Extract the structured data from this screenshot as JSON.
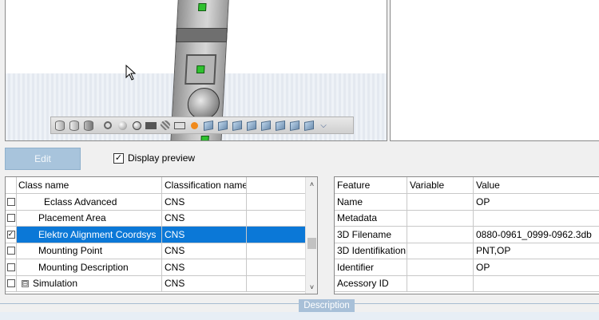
{
  "toolbar": {
    "edit_label": "Edit",
    "display_preview_label": "Display preview",
    "display_preview_checked": true
  },
  "class_table": {
    "headers": [
      "Class name",
      "Classification name"
    ],
    "rows": [
      {
        "name": "Eclass Advanced",
        "classification": "CNS",
        "checked": false,
        "selected": false,
        "indent": 2
      },
      {
        "name": "Placement Area",
        "classification": "CNS",
        "checked": false,
        "selected": false,
        "indent": 1
      },
      {
        "name": "Elektro Alignment Coordsys",
        "classification": "CNS",
        "checked": true,
        "selected": true,
        "indent": 1
      },
      {
        "name": "Mounting Point",
        "classification": "CNS",
        "checked": false,
        "selected": false,
        "indent": 1
      },
      {
        "name": "Mounting Description",
        "classification": "CNS",
        "checked": false,
        "selected": false,
        "indent": 1
      },
      {
        "name": "Simulation",
        "classification": "CNS",
        "checked": false,
        "selected": false,
        "indent": 0,
        "expander": "⊟"
      }
    ]
  },
  "feature_table": {
    "headers": [
      "Feature",
      "Variable",
      "Value"
    ],
    "rows": [
      {
        "feature": "Name",
        "variable": "",
        "value": "OP"
      },
      {
        "feature": "Metadata",
        "variable": "",
        "value": ""
      },
      {
        "feature": "3D Filename",
        "variable": "",
        "value": "0880-0961_0999-0962.3db"
      },
      {
        "feature": "3D Identifikation",
        "variable": "",
        "value": "PNT,OP"
      },
      {
        "feature": "Identifier",
        "variable": "",
        "value": "OP"
      },
      {
        "feature": "Acessory ID",
        "variable": "",
        "value": ""
      }
    ]
  },
  "description_tab": "Description",
  "colors": {
    "selection": "#0b78d7",
    "edit_button": "#a8c4dc",
    "description_tab": "#a8c0d8"
  },
  "icons": {
    "viewer_toolbar": [
      "cylinder-icon",
      "cylinder-icon",
      "cylinder-dark-icon",
      "zoom-icon",
      "sphere-icon",
      "rotate-icon",
      "frame-icon",
      "grid-sphere-icon",
      "box-icon",
      "orange-dot-icon",
      "cube-icon",
      "cube-icon",
      "cube-icon",
      "cube-icon",
      "cube-icon",
      "cube-icon",
      "cube-icon",
      "cube-icon",
      "chevron-down-icon"
    ]
  }
}
